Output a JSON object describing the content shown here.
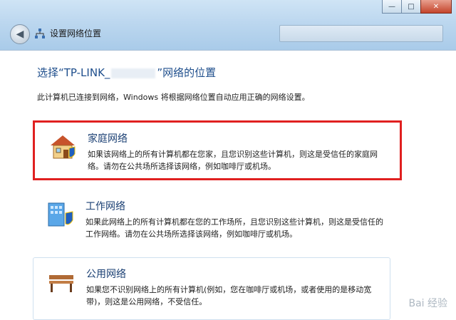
{
  "window": {
    "title": "设置网络位置",
    "controls": {
      "minimize": "—",
      "maximize": "□",
      "close": "✕"
    }
  },
  "page": {
    "heading_prefix": "选择“TP-LINK_",
    "heading_suffix": "”网络的位置",
    "description": "此计算机已连接到网络，Windows 将根据网络位置自动应用正确的网络设置。"
  },
  "options": [
    {
      "title": "家庭网络",
      "text": "如果该网络上的所有计算机都在您家，且您识别这些计算机，则这是受信任的家庭网络。请勿在公共场所选择该网络，例如咖啡厅或机场。",
      "icon": "home-network-icon"
    },
    {
      "title": "工作网络",
      "text": "如果此网络上的所有计算机都在您的工作场所，且您识别这些计算机，则这是受信任的工作网络。请勿在公共场所选择该网络，例如咖啡厅或机场。",
      "icon": "work-network-icon"
    },
    {
      "title": "公用网络",
      "text": "如果您不识别网络上的所有计算机(例如，您在咖啡厅或机场，或者使用的是移动宽带)，则这是公用网络，不受信任。",
      "icon": "public-network-icon"
    }
  ],
  "watermark": "Bai 经验",
  "colors": {
    "heading": "#1e4e8c",
    "highlight_border": "#e02020"
  }
}
